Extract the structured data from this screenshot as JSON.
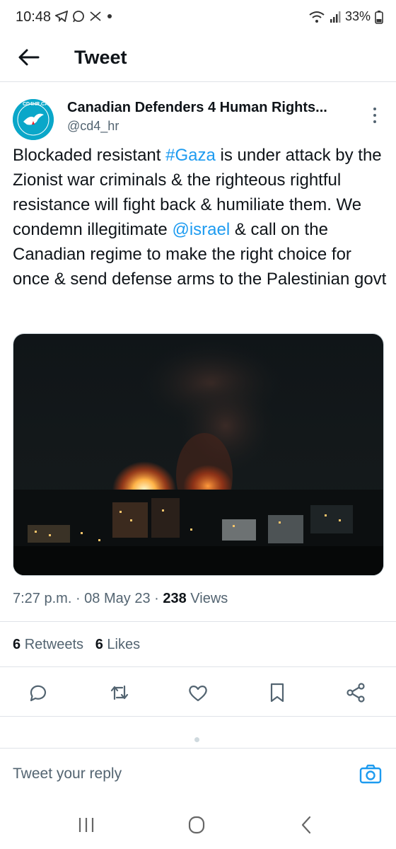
{
  "status_bar": {
    "time": "10:48",
    "battery": "33%"
  },
  "header": {
    "title": "Tweet"
  },
  "tweet": {
    "author_name": "Canadian Defenders 4 Human Rights...",
    "handle": "@cd4_hr",
    "avatar_text": "CD4HR.CA",
    "text_part1": "Blockaded resistant ",
    "hashtag": "#Gaza",
    "text_part2": " is under attack by the Zionist war criminals & the righteous rightful resistance will fight back & humiliate them. We condemn illegitimate ",
    "mention": "@israel",
    "text_part3": " & call on the Canadian regime to make the right choice for once & send defense arms to the Palestinian govt",
    "time": "7:27 p.m.",
    "date": "08 May 23",
    "views_count": "238",
    "views_label": "Views",
    "retweets_count": "6",
    "retweets_label": "Retweets",
    "likes_count": "6",
    "likes_label": "Likes"
  },
  "reply": {
    "placeholder": "Tweet your reply"
  },
  "colors": {
    "accent": "#1d9bf0",
    "text": "#0f1419",
    "muted": "#536471",
    "avatar": "#0aa7c9"
  },
  "icons": [
    "back-arrow-icon",
    "more-vertical-icon",
    "reply-icon",
    "retweet-icon",
    "like-icon",
    "bookmark-icon",
    "share-icon",
    "camera-icon",
    "recents-icon",
    "home-icon",
    "back-icon"
  ]
}
